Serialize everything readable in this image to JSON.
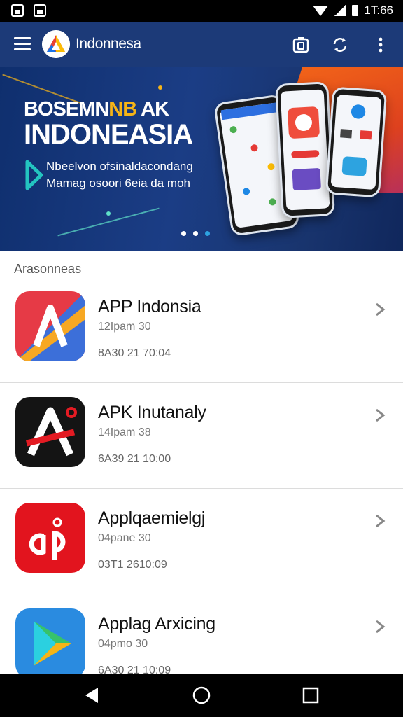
{
  "status_bar": {
    "time": "1T:66"
  },
  "app_bar": {
    "title": "Indonnesa",
    "menu_icon": "hamburger-menu-icon",
    "actions": [
      "camera-icon",
      "sync-icon",
      "more-vertical-icon"
    ]
  },
  "banner": {
    "kicker_a": "BOSEMN",
    "kicker_b": "NB",
    "kicker_c": " AK",
    "title": "INDONEASIA",
    "line1": "Nbeelvon ofsinaldacondang",
    "line2": "Mamag osoori 6eia da moh",
    "slides": 3,
    "active_slide": 3
  },
  "section": {
    "title": "Arasonneas"
  },
  "apps": [
    {
      "name": "APP Indonsia",
      "meta1": "12Ipam 30",
      "meta2": "8A30 21 70:04",
      "icon": "app-indonsia-logo-icon"
    },
    {
      "name": "APK Inutanaly",
      "meta1": "14Ipam 38",
      "meta2": "6A39 21 10:00",
      "icon": "apk-inutanaly-logo-icon"
    },
    {
      "name": "Applqaemielgj",
      "meta1": "04pane 30",
      "meta2": "03T1 2610:09",
      "icon": "applqaemielgj-logo-icon"
    },
    {
      "name": "Applag Arxicing",
      "meta1": "04pmo 30",
      "meta2": "6A30 21 10:09",
      "icon": "play-triangle-logo-icon"
    }
  ],
  "colors": {
    "app_bar": "#1c3a78",
    "accent": "#2da3e0",
    "banner_orange": "#ff6a13"
  },
  "nav_bar": [
    "back-icon",
    "home-icon",
    "recent-apps-icon"
  ]
}
